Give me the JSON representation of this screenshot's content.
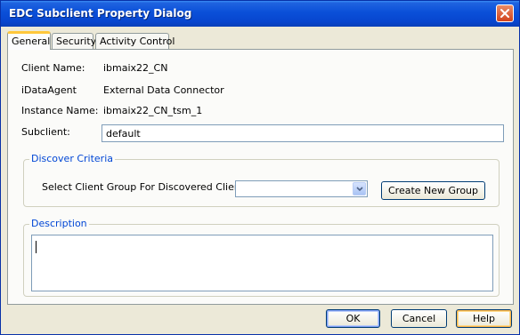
{
  "window": {
    "title": "EDC Subclient Property Dialog"
  },
  "tabs": [
    {
      "label": "General"
    },
    {
      "label": "Security"
    },
    {
      "label": "Activity Control"
    }
  ],
  "general": {
    "client_name_label": "Client Name:",
    "client_name_value": "ibmaix22_CN",
    "idataagent_label": "iDataAgent",
    "idataagent_value": "External Data Connector",
    "instance_name_label": "Instance Name:",
    "instance_name_value": "ibmaix22_CN_tsm_1",
    "subclient_label": "Subclient:",
    "subclient_value": "default"
  },
  "discover": {
    "group_title": "Discover Criteria",
    "select_label": "Select Client Group For Discovered Clients",
    "select_value": "",
    "create_button": "Create New Group"
  },
  "description": {
    "group_title": "Description",
    "value": ""
  },
  "buttons": {
    "ok": "OK",
    "cancel": "Cancel",
    "help": "Help"
  },
  "colors": {
    "titlebar": "#0a4fd8",
    "dialog_bg": "#ece9d8",
    "group_title": "#0046d5",
    "active_tab_accent": "#ffc73c"
  }
}
